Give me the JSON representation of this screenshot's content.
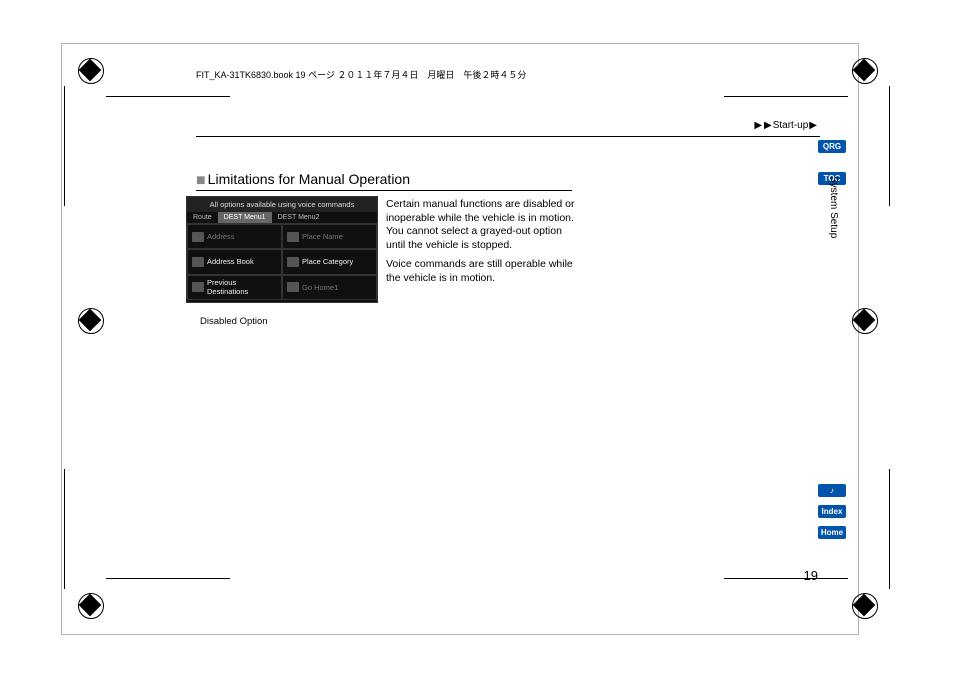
{
  "header": {
    "line": "FIT_KA-31TK6830.book  19 ページ  ２０１１年７月４日　月曜日　午後２時４５分"
  },
  "breadcrumb": {
    "arrow": "▶",
    "label": "Start-up"
  },
  "sidebar": {
    "qrg": "QRG",
    "toc": "TOC",
    "voice": "♪",
    "index": "Index",
    "home": "Home"
  },
  "section_label": "System Setup",
  "heading": {
    "marker": "■",
    "text": "Limitations for Manual Operation"
  },
  "device": {
    "topbar": "All options available using voice commands",
    "tabs": {
      "route": "Route",
      "menu1": "DEST Menu1",
      "menu2": "DEST Menu2"
    },
    "cells": {
      "address": "Address",
      "place_name": "Place Name",
      "address_book": "Address Book",
      "place_category": "Place Category",
      "previous": "Previous Destinations",
      "go_home": "Go Home1"
    }
  },
  "caption": "Disabled Option",
  "paragraph1": "Certain manual functions are disabled or inoperable while the vehicle is in motion. You cannot select a grayed-out option until the vehicle is stopped.",
  "paragraph2": "Voice commands are still operable while the vehicle is in motion.",
  "page_number": "19"
}
